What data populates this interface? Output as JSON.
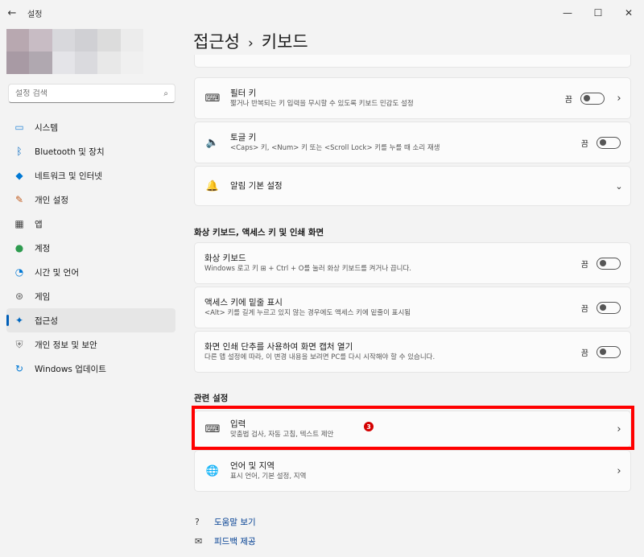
{
  "window": {
    "title": "설정",
    "back": "←",
    "minimize": "—",
    "maximize": "☐",
    "close": "✕"
  },
  "search": {
    "placeholder": "설정 검색",
    "icon": "⌕"
  },
  "nav": [
    {
      "label": "시스템",
      "icon": "▭",
      "name": "nav-system"
    },
    {
      "label": "Bluetooth 및 장치",
      "icon": "ᛒ",
      "name": "nav-bluetooth"
    },
    {
      "label": "네트워크 및 인터넷",
      "icon": "◆",
      "name": "nav-network"
    },
    {
      "label": "개인 설정",
      "icon": "✎",
      "name": "nav-personalization"
    },
    {
      "label": "앱",
      "icon": "▦",
      "name": "nav-apps"
    },
    {
      "label": "계정",
      "icon": "●",
      "name": "nav-accounts"
    },
    {
      "label": "시간 및 언어",
      "icon": "◔",
      "name": "nav-time-language"
    },
    {
      "label": "게임",
      "icon": "⊛",
      "name": "nav-gaming"
    },
    {
      "label": "접근성",
      "icon": "✦",
      "name": "nav-accessibility"
    },
    {
      "label": "개인 정보 및 보안",
      "icon": "⛨",
      "name": "nav-privacy"
    },
    {
      "label": "Windows 업데이트",
      "icon": "↻",
      "name": "nav-windows-update"
    }
  ],
  "page": {
    "parent": "접근성",
    "separator": "›",
    "current": "키보드"
  },
  "cards": {
    "filter_keys": {
      "title": "필터 키",
      "subtitle": "짧거나 반복되는 키 입력을 무시할 수 있도록 키보드 민감도 설정",
      "state": "끔",
      "icon": "⌨"
    },
    "toggle_keys": {
      "title": "토글 키",
      "subtitle": "<Caps> 키, <Num> 키 또는 <Scroll Lock> 키를 누를 때 소리 재생",
      "state": "끔",
      "icon": "🔈"
    },
    "notification": {
      "title": "알림 기본 설정",
      "icon": "🔔"
    }
  },
  "section_onscreen": {
    "heading": "화상 키보드, 액세스 키 및 인쇄 화면",
    "osk": {
      "title": "화상 키보드",
      "subtitle": "Windows 로고 키 ⊞ + Ctrl + O를 눌러 화상 키보드를 켜거나 끕니다.",
      "state": "끔"
    },
    "access_keys": {
      "title": "액세스 키에 밑줄 표시",
      "subtitle": "<Alt> 키를 길게 누르고 있지 않는 경우에도 액세스 키에 밑줄이 표시됨",
      "state": "끔"
    },
    "print_screen": {
      "title": "화면 인쇄 단추를 사용하여 화면 캡처 열기",
      "subtitle": "다른 앱 설정에 따라, 이 변경 내용을 보려면 PC를 다시 시작해야 할 수 있습니다.",
      "state": "끔"
    }
  },
  "section_related": {
    "heading": "관련 설정",
    "typing": {
      "title": "입력",
      "subtitle": "맞춤법 검사, 자동 고침, 텍스트 제안",
      "icon": "⌨"
    },
    "language": {
      "title": "언어 및 지역",
      "subtitle": "표시 언어, 기본 설정, 지역",
      "icon": "🌐"
    },
    "badge": "3"
  },
  "links": {
    "help": "도움말 보기",
    "feedback": "피드백 제공"
  },
  "colors": {
    "accent": "#005fb8",
    "highlight": "#ff0000"
  }
}
